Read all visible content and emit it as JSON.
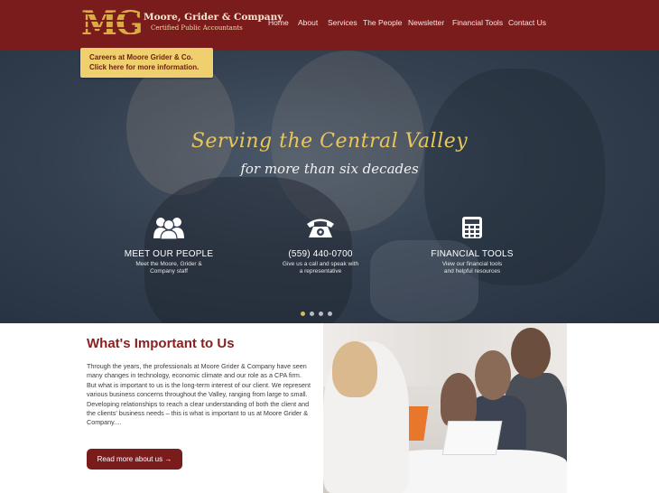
{
  "brand": {
    "logo_text": "MG",
    "name": "Moore, Grider & Company",
    "subtitle": "Certified Public Accountants",
    "primary_color": "#7b1c1c",
    "gold_color": "#d9ac45"
  },
  "nav": {
    "items": [
      {
        "label": "Home"
      },
      {
        "label": "About"
      },
      {
        "label": "Services"
      },
      {
        "label": "The People"
      },
      {
        "label": "Newsletter"
      },
      {
        "label": "Financial Tools"
      },
      {
        "label": "Contact Us"
      }
    ]
  },
  "careers_banner": {
    "line1": "Careers at Moore Grider & Co.",
    "line2": "Click here for more information."
  },
  "hero": {
    "tagline": "Serving the Central Valley",
    "subtagline": "for more than six decades",
    "features": [
      {
        "icon": "people-icon",
        "title": "MEET OUR PEOPLE",
        "desc_line1": "Meet the Moore, Grider &",
        "desc_line2": "Company staff"
      },
      {
        "icon": "telephone-icon",
        "title": "(559) 440-0700",
        "desc_line1": "Give us a call and speak with",
        "desc_line2": "a representative"
      },
      {
        "icon": "calculator-icon",
        "title": "FINANCIAL TOOLS",
        "desc_line1": "View our financial tools",
        "desc_line2": "and helpful resources"
      }
    ],
    "slides": {
      "count": 4,
      "active_index": 0
    }
  },
  "content": {
    "title": "What's Important to Us",
    "body": "Through the years, the professionals at Moore Grider & Company have seen many changes in technology, economic climate and our role as a CPA firm. But what is important to us is the long-term interest of our client. We represent various business concerns throughout the Valley, ranging from large to small. Developing relationships to reach a clear understanding of both the client and the clients' business needs – this is what is important to us at Moore Grider & Company....",
    "button_label": "Read more about us →"
  }
}
